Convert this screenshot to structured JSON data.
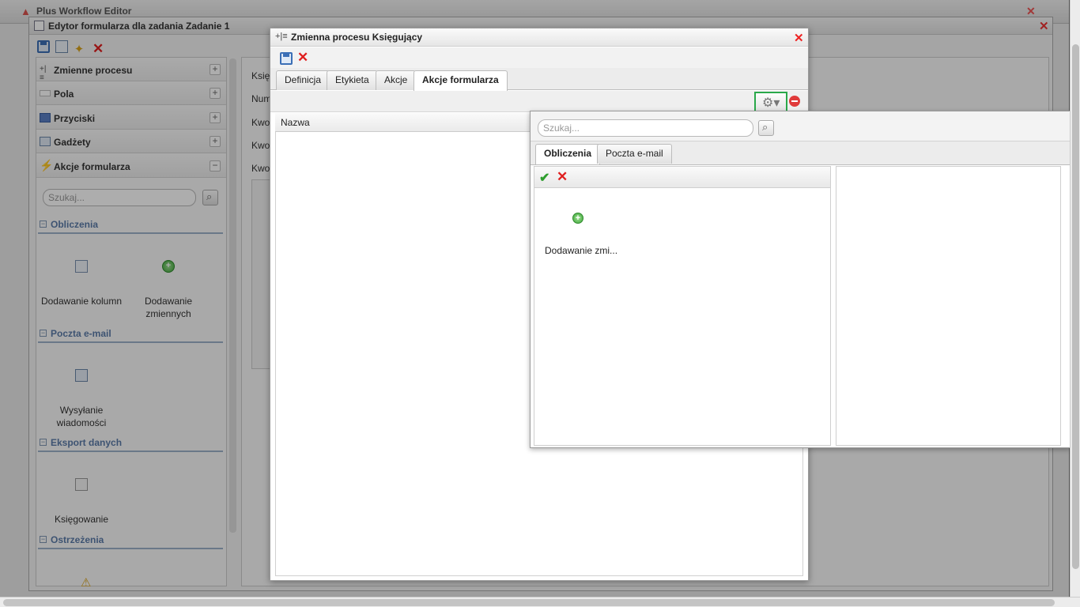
{
  "app": {
    "title": "Plus Workflow Editor"
  },
  "editor": {
    "title": "Edytor formularza dla zadania Zadanie 1",
    "accordion": [
      {
        "label": "Zmienne procesu",
        "state": "+"
      },
      {
        "label": "Pola",
        "state": "+"
      },
      {
        "label": "Przyciski",
        "state": "+"
      },
      {
        "label": "Gadżety",
        "state": "+"
      },
      {
        "label": "Akcje formularza",
        "state": "−"
      }
    ],
    "search_placeholder": "Szukaj...",
    "sections": {
      "obliczenia": "Obliczenia",
      "poczta": "Poczta e-mail",
      "eksport": "Eksport danych",
      "ostrzezenia": "Ostrzeżenia"
    },
    "tools": {
      "dodawanie_kolumn": "Dodawanie kolumn",
      "dodawanie_zmiennych_1": "Dodawanie",
      "dodawanie_zmiennych_2": "zmiennych",
      "wysylanie_1": "Wysyłanie",
      "wysylanie_2": "wiadomości",
      "ksiegowanie": "Księgowanie"
    },
    "mid_labels": [
      "Księg",
      "Num",
      "Kwot",
      "Kwot",
      "Kwot"
    ]
  },
  "dialog": {
    "title": "Zmienna procesu Księgujący",
    "tabs": [
      "Definicja",
      "Etykieta",
      "Akcje",
      "Akcje formularza"
    ],
    "active_tab": "Akcje formularza",
    "grid_header": "Nazwa"
  },
  "popup": {
    "search_placeholder": "Szukaj...",
    "tabs": [
      "Obliczenia",
      "Poczta e-mail"
    ],
    "item_label": "Dodawanie zmi..."
  },
  "colors": {
    "highlight": "#2aa84a",
    "section": "#5b7ba8",
    "close": "#e22"
  }
}
